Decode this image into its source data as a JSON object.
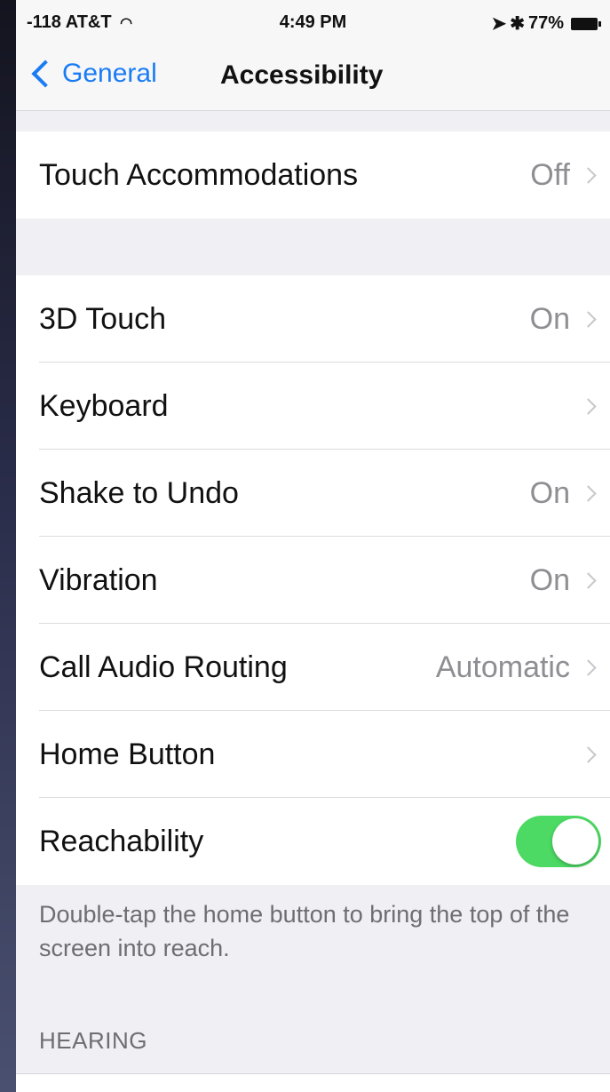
{
  "status_bar": {
    "carrier": "-118 AT&T",
    "time": "4:49 PM",
    "bluetooth": "✱",
    "battery": "77%"
  },
  "nav": {
    "back_label": "General",
    "title": "Accessibility"
  },
  "group1": [
    {
      "label": "Touch Accommodations",
      "value": "Off"
    }
  ],
  "group2": [
    {
      "label": "3D Touch",
      "value": "On"
    },
    {
      "label": "Keyboard",
      "value": ""
    },
    {
      "label": "Shake to Undo",
      "value": "On"
    },
    {
      "label": "Vibration",
      "value": "On"
    },
    {
      "label": "Call Audio Routing",
      "value": "Automatic"
    },
    {
      "label": "Home Button",
      "value": ""
    },
    {
      "label": "Reachability",
      "toggle": true
    }
  ],
  "reachability_footer": "Double-tap the home button to bring the top of the screen into reach.",
  "hearing_header": "HEARING",
  "colors": {
    "accent": "#1a7cf5",
    "toggle_on": "#4cd964"
  }
}
